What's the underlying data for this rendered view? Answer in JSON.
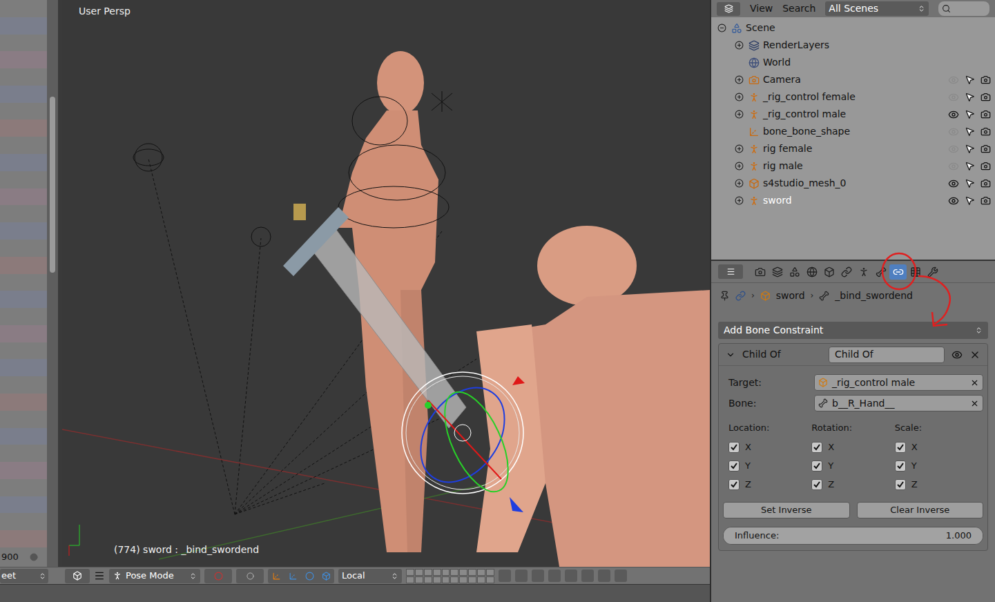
{
  "viewport": {
    "label": "User Persp",
    "status": "(774) sword : _bind_swordend"
  },
  "timeline": {
    "frame": "900"
  },
  "header": {
    "editor_menu": "eet",
    "mode": "Pose Mode",
    "orientation": "Local"
  },
  "outliner": {
    "menus": [
      "View",
      "Search"
    ],
    "scene_filter": "All Scenes",
    "items": [
      {
        "name": "Scene",
        "kind": "scene",
        "depth": 0,
        "expanded": true
      },
      {
        "name": "RenderLayers",
        "kind": "renderlayers",
        "depth": 1,
        "expanded": false
      },
      {
        "name": "World",
        "kind": "world",
        "depth": 1
      },
      {
        "name": "Camera",
        "kind": "camera",
        "depth": 1,
        "expanded": false,
        "visible": false
      },
      {
        "name": "_rig_control female",
        "kind": "armature",
        "depth": 1,
        "expanded": false,
        "visible": false
      },
      {
        "name": "_rig_control male",
        "kind": "armature",
        "depth": 1,
        "expanded": false,
        "visible": true
      },
      {
        "name": "bone_bone_shape",
        "kind": "empty",
        "depth": 1,
        "visible": false
      },
      {
        "name": "rig female",
        "kind": "armature",
        "depth": 1,
        "expanded": false,
        "visible": false
      },
      {
        "name": "rig male",
        "kind": "armature",
        "depth": 1,
        "expanded": false,
        "visible": false
      },
      {
        "name": "s4studio_mesh_0",
        "kind": "mesh",
        "depth": 1,
        "expanded": false,
        "visible": true
      },
      {
        "name": "sword",
        "kind": "armature_active",
        "depth": 1,
        "expanded": false,
        "visible": true
      }
    ]
  },
  "properties": {
    "tabs": [
      {
        "kind": "render",
        "selected": false
      },
      {
        "kind": "layers",
        "selected": false
      },
      {
        "kind": "scene",
        "selected": false
      },
      {
        "kind": "world",
        "selected": false
      },
      {
        "kind": "object",
        "selected": false
      },
      {
        "kind": "constraints",
        "selected": false
      },
      {
        "kind": "data",
        "selected": false
      },
      {
        "kind": "bone",
        "selected": false
      },
      {
        "kind": "bone_constraints",
        "selected": true
      },
      {
        "kind": "texture",
        "selected": false
      },
      {
        "kind": "modifiers",
        "selected": false
      }
    ],
    "breadcrumb": [
      {
        "kind": "object",
        "label": "sword"
      },
      {
        "kind": "bone",
        "label": "_bind_swordend"
      }
    ],
    "add_menu": "Add Bone Constraint",
    "constraint": {
      "type_label": "Child Of",
      "name": "Child Of",
      "expanded": true,
      "enabled": true,
      "fields": [
        {
          "label": "Target:",
          "value": "_rig_control male",
          "kind": "object"
        },
        {
          "label": "Bone:",
          "value": "b__R_Hand__",
          "kind": "bone"
        }
      ],
      "groups": [
        {
          "label": "Location:",
          "axes": [
            {
              "axis": "X",
              "checked": true
            },
            {
              "axis": "Y",
              "checked": true
            },
            {
              "axis": "Z",
              "checked": true
            }
          ]
        },
        {
          "label": "Rotation:",
          "axes": [
            {
              "axis": "X",
              "checked": true
            },
            {
              "axis": "Y",
              "checked": true
            },
            {
              "axis": "Z",
              "checked": true
            }
          ]
        },
        {
          "label": "Scale:",
          "axes": [
            {
              "axis": "X",
              "checked": true
            },
            {
              "axis": "Y",
              "checked": true
            },
            {
              "axis": "Z",
              "checked": true
            }
          ]
        }
      ],
      "buttons": [
        "Set Inverse",
        "Clear Inverse"
      ],
      "influence": {
        "label": "Influence:",
        "value": "1.000",
        "level": 1
      }
    }
  }
}
